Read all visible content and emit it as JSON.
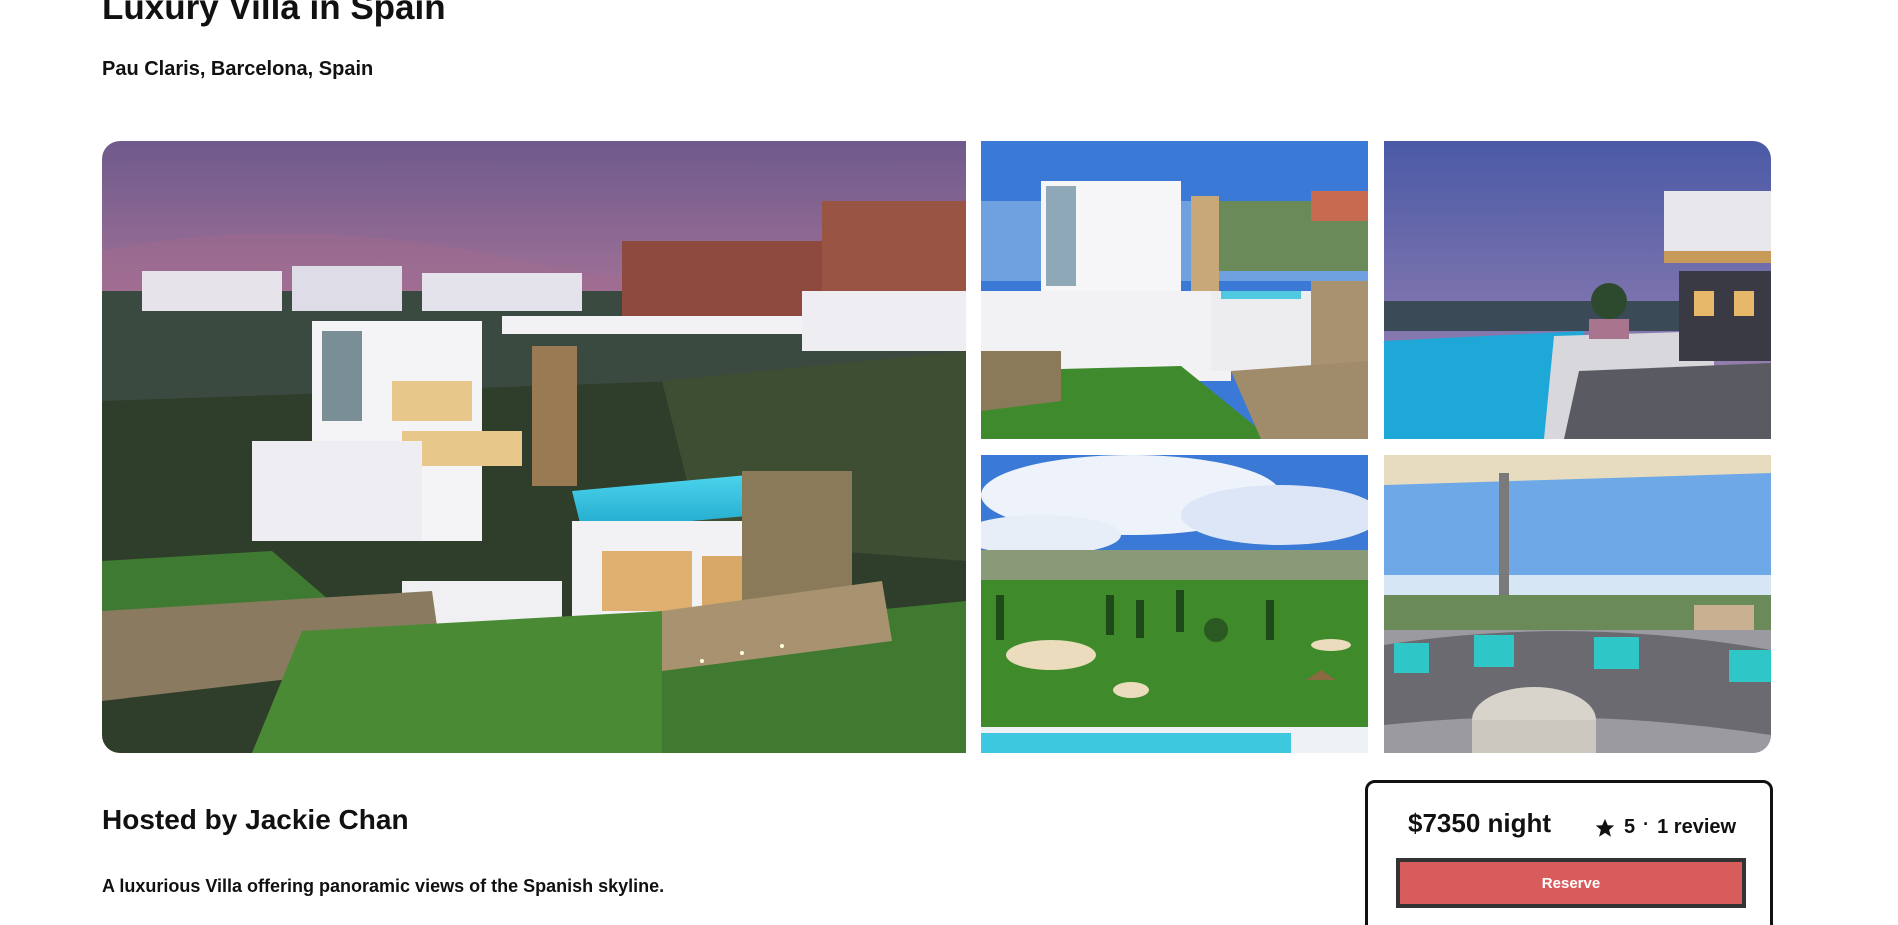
{
  "listing": {
    "title": "Luxury Villa in Spain",
    "location": "Pau Claris, Barcelona, Spain"
  },
  "gallery": {
    "photos": [
      "villa-exterior-dusk",
      "villa-exterior-day",
      "infinity-pool-terrace",
      "golf-course-view",
      "lounge-terrace-view"
    ]
  },
  "host": {
    "title": "Hosted by Jackie Chan",
    "description": "A luxurious Villa offering panoramic views of the Spanish skyline."
  },
  "booking": {
    "price": "$7350 night",
    "rating": "5",
    "separator": "·",
    "reviews": "1 review",
    "reserve_label": "Reserve",
    "accent_color": "#d95c5c"
  }
}
